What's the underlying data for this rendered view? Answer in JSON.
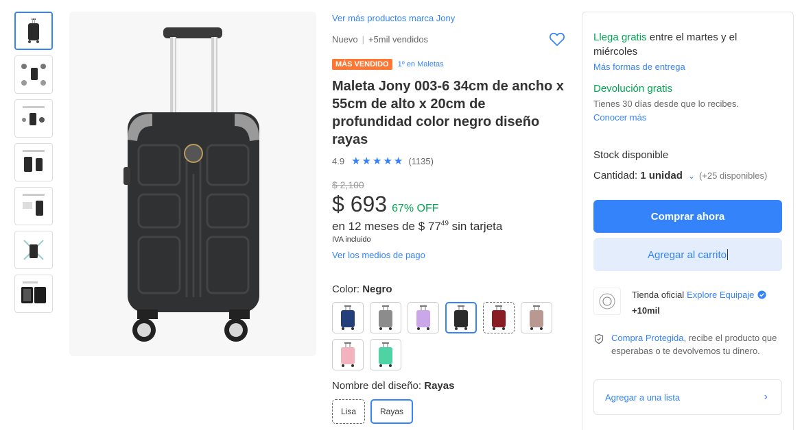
{
  "brand_link": "Ver más productos marca Jony",
  "condition": "Nuevo",
  "sold": "+5mil vendidos",
  "badge_best_seller": "MÁS VENDIDO",
  "badge_rank": "1º en Maletas",
  "title": "Maleta Jony 003-6 34cm de ancho x 55cm de alto x 20cm de profundidad color negro diseño rayas",
  "rating": {
    "score": "4.9",
    "count": "(1135)",
    "stars": 5
  },
  "old_price": "$ 2,100",
  "price": "$ 693",
  "discount": "67% OFF",
  "installments": {
    "prefix": "en 12 meses de $ 77",
    "cents": "49",
    "suffix": "sin tarjeta"
  },
  "tax_note": "IVA incluido",
  "payment_link": "Ver los medios de pago",
  "color": {
    "label": "Color:",
    "selected": "Negro",
    "options": [
      {
        "name": "azul",
        "hex": "#24407a"
      },
      {
        "name": "gris",
        "hex": "#8c8c8c"
      },
      {
        "name": "lila",
        "hex": "#c9a7e8"
      },
      {
        "name": "negro",
        "hex": "#2b2b2b"
      },
      {
        "name": "rojo",
        "hex": "#8a1c24"
      },
      {
        "name": "rosa-oro",
        "hex": "#b99891"
      },
      {
        "name": "rosa",
        "hex": "#f2b3bf"
      },
      {
        "name": "verde-menta",
        "hex": "#4fd3a4"
      }
    ]
  },
  "design": {
    "label": "Nombre del diseño:",
    "selected": "Rayas",
    "options": [
      "Lisa",
      "Rayas"
    ]
  },
  "shipping": {
    "free": "Llega gratis",
    "rest": " entre el martes y el miércoles",
    "more_link": "Más formas de entrega"
  },
  "returns": {
    "title": "Devolución gratis",
    "subtitle": "Tienes 30 días desde que lo recibes.",
    "link": "Conocer más"
  },
  "stock": "Stock disponible",
  "quantity": {
    "label": "Cantidad:",
    "value": "1 unidad",
    "available": "(+25 disponibles)"
  },
  "buy_button": "Comprar ahora",
  "cart_button": "Agregar al carrito",
  "seller": {
    "prefix": "Tienda oficial",
    "name": "Explore Equipaje",
    "sales": "+10mil"
  },
  "protection": {
    "link": "Compra Protegida",
    "text": ", recibe el producto que esperabas o te devolvemos tu dinero."
  },
  "list_button": "Agregar a una lista",
  "colors": {
    "accent": "#3483fa",
    "green": "#00a650",
    "best_seller": "#ff7733"
  }
}
